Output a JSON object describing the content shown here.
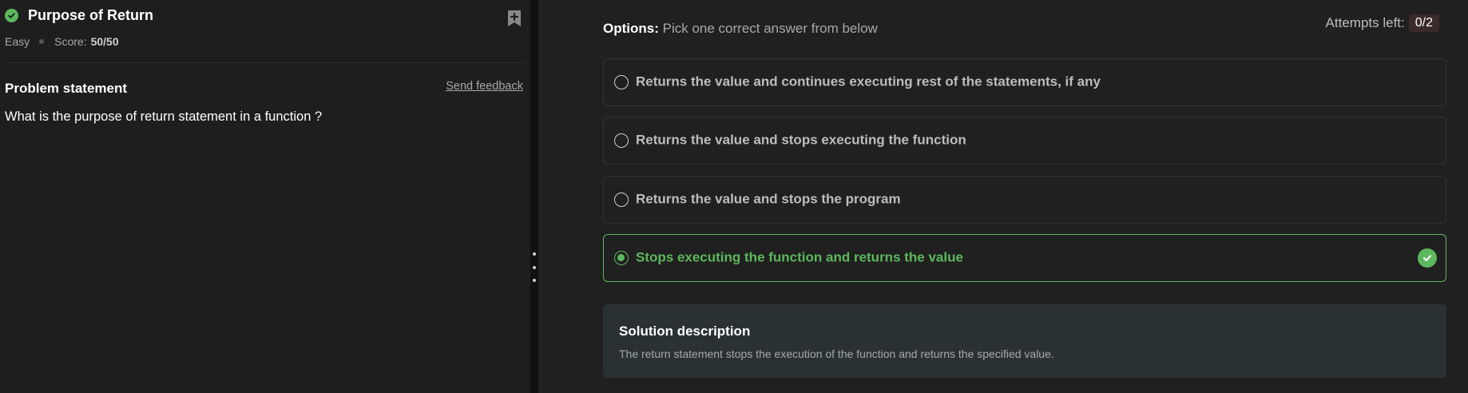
{
  "question": {
    "title": "Purpose of Return",
    "difficulty": "Easy",
    "score_label": "Score:",
    "score_value": "50/50",
    "status_icon": "check-circle-icon",
    "bookmark_icon": "bookmark-plus-icon"
  },
  "problem": {
    "heading": "Problem statement",
    "feedback_link": "Send feedback",
    "statement": "What is the purpose of return statement in a function ?"
  },
  "options": {
    "label": "Options:",
    "hint": "Pick one correct answer from below",
    "attempts_label": "Attempts left:",
    "attempts_value": "0/2",
    "items": [
      {
        "text": "Returns the value and continues executing rest of the statements, if any",
        "selected": false,
        "correct": false
      },
      {
        "text": "Returns the value and stops executing the function",
        "selected": false,
        "correct": false
      },
      {
        "text": "Returns the value and stops the program",
        "selected": false,
        "correct": false
      },
      {
        "text": "Stops executing the function and returns the value",
        "selected": true,
        "correct": true
      }
    ]
  },
  "solution": {
    "title": "Solution description",
    "text": "The return statement stops the execution of the function and returns the specified value."
  },
  "colors": {
    "success": "#5cb85c",
    "background": "#1f1f1f",
    "solution_bg": "#2a3135",
    "attempts_badge_bg": "#3b2a2a"
  }
}
